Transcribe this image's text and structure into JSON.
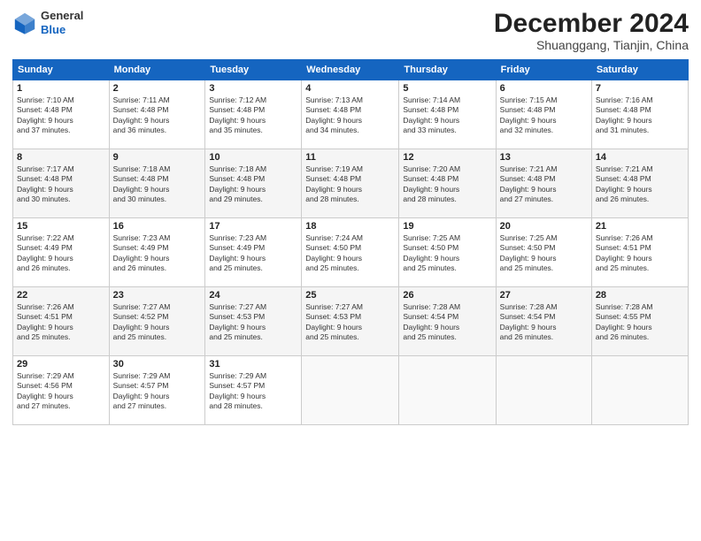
{
  "header": {
    "logo_general": "General",
    "logo_blue": "Blue",
    "month_title": "December 2024",
    "location": "Shuanggang, Tianjin, China"
  },
  "columns": [
    "Sunday",
    "Monday",
    "Tuesday",
    "Wednesday",
    "Thursday",
    "Friday",
    "Saturday"
  ],
  "weeks": [
    [
      {
        "day": "1",
        "info": "Sunrise: 7:10 AM\nSunset: 4:48 PM\nDaylight: 9 hours\nand 37 minutes."
      },
      {
        "day": "2",
        "info": "Sunrise: 7:11 AM\nSunset: 4:48 PM\nDaylight: 9 hours\nand 36 minutes."
      },
      {
        "day": "3",
        "info": "Sunrise: 7:12 AM\nSunset: 4:48 PM\nDaylight: 9 hours\nand 35 minutes."
      },
      {
        "day": "4",
        "info": "Sunrise: 7:13 AM\nSunset: 4:48 PM\nDaylight: 9 hours\nand 34 minutes."
      },
      {
        "day": "5",
        "info": "Sunrise: 7:14 AM\nSunset: 4:48 PM\nDaylight: 9 hours\nand 33 minutes."
      },
      {
        "day": "6",
        "info": "Sunrise: 7:15 AM\nSunset: 4:48 PM\nDaylight: 9 hours\nand 32 minutes."
      },
      {
        "day": "7",
        "info": "Sunrise: 7:16 AM\nSunset: 4:48 PM\nDaylight: 9 hours\nand 31 minutes."
      }
    ],
    [
      {
        "day": "8",
        "info": "Sunrise: 7:17 AM\nSunset: 4:48 PM\nDaylight: 9 hours\nand 30 minutes."
      },
      {
        "day": "9",
        "info": "Sunrise: 7:18 AM\nSunset: 4:48 PM\nDaylight: 9 hours\nand 30 minutes."
      },
      {
        "day": "10",
        "info": "Sunrise: 7:18 AM\nSunset: 4:48 PM\nDaylight: 9 hours\nand 29 minutes."
      },
      {
        "day": "11",
        "info": "Sunrise: 7:19 AM\nSunset: 4:48 PM\nDaylight: 9 hours\nand 28 minutes."
      },
      {
        "day": "12",
        "info": "Sunrise: 7:20 AM\nSunset: 4:48 PM\nDaylight: 9 hours\nand 28 minutes."
      },
      {
        "day": "13",
        "info": "Sunrise: 7:21 AM\nSunset: 4:48 PM\nDaylight: 9 hours\nand 27 minutes."
      },
      {
        "day": "14",
        "info": "Sunrise: 7:21 AM\nSunset: 4:48 PM\nDaylight: 9 hours\nand 26 minutes."
      }
    ],
    [
      {
        "day": "15",
        "info": "Sunrise: 7:22 AM\nSunset: 4:49 PM\nDaylight: 9 hours\nand 26 minutes."
      },
      {
        "day": "16",
        "info": "Sunrise: 7:23 AM\nSunset: 4:49 PM\nDaylight: 9 hours\nand 26 minutes."
      },
      {
        "day": "17",
        "info": "Sunrise: 7:23 AM\nSunset: 4:49 PM\nDaylight: 9 hours\nand 25 minutes."
      },
      {
        "day": "18",
        "info": "Sunrise: 7:24 AM\nSunset: 4:50 PM\nDaylight: 9 hours\nand 25 minutes."
      },
      {
        "day": "19",
        "info": "Sunrise: 7:25 AM\nSunset: 4:50 PM\nDaylight: 9 hours\nand 25 minutes."
      },
      {
        "day": "20",
        "info": "Sunrise: 7:25 AM\nSunset: 4:50 PM\nDaylight: 9 hours\nand 25 minutes."
      },
      {
        "day": "21",
        "info": "Sunrise: 7:26 AM\nSunset: 4:51 PM\nDaylight: 9 hours\nand 25 minutes."
      }
    ],
    [
      {
        "day": "22",
        "info": "Sunrise: 7:26 AM\nSunset: 4:51 PM\nDaylight: 9 hours\nand 25 minutes."
      },
      {
        "day": "23",
        "info": "Sunrise: 7:27 AM\nSunset: 4:52 PM\nDaylight: 9 hours\nand 25 minutes."
      },
      {
        "day": "24",
        "info": "Sunrise: 7:27 AM\nSunset: 4:53 PM\nDaylight: 9 hours\nand 25 minutes."
      },
      {
        "day": "25",
        "info": "Sunrise: 7:27 AM\nSunset: 4:53 PM\nDaylight: 9 hours\nand 25 minutes."
      },
      {
        "day": "26",
        "info": "Sunrise: 7:28 AM\nSunset: 4:54 PM\nDaylight: 9 hours\nand 25 minutes."
      },
      {
        "day": "27",
        "info": "Sunrise: 7:28 AM\nSunset: 4:54 PM\nDaylight: 9 hours\nand 26 minutes."
      },
      {
        "day": "28",
        "info": "Sunrise: 7:28 AM\nSunset: 4:55 PM\nDaylight: 9 hours\nand 26 minutes."
      }
    ],
    [
      {
        "day": "29",
        "info": "Sunrise: 7:29 AM\nSunset: 4:56 PM\nDaylight: 9 hours\nand 27 minutes."
      },
      {
        "day": "30",
        "info": "Sunrise: 7:29 AM\nSunset: 4:57 PM\nDaylight: 9 hours\nand 27 minutes."
      },
      {
        "day": "31",
        "info": "Sunrise: 7:29 AM\nSunset: 4:57 PM\nDaylight: 9 hours\nand 28 minutes."
      },
      {
        "day": "",
        "info": ""
      },
      {
        "day": "",
        "info": ""
      },
      {
        "day": "",
        "info": ""
      },
      {
        "day": "",
        "info": ""
      }
    ]
  ]
}
